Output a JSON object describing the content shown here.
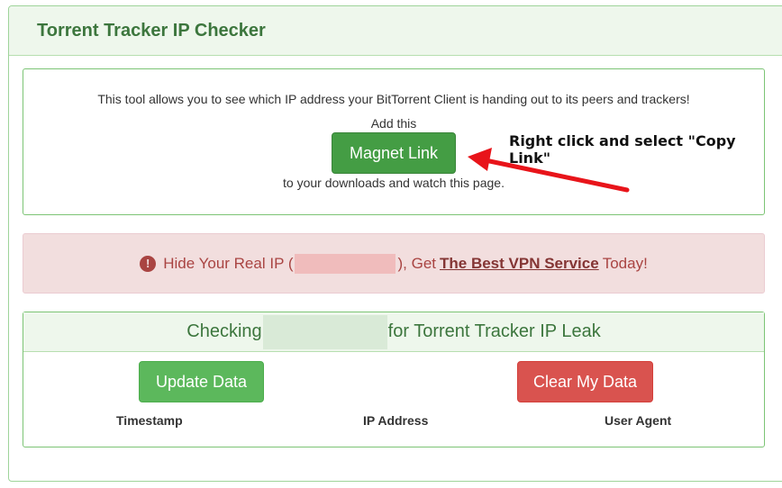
{
  "panel": {
    "title": "Torrent Tracker IP Checker"
  },
  "intro": {
    "description": "This tool allows you to see which IP address your BitTorrent Client is handing out to its peers and trackers!",
    "add_this": "Add this",
    "magnet_button": "Magnet Link",
    "after": "to your downloads and watch this page.",
    "annotation": "Right click and select \"Copy Link\""
  },
  "alert": {
    "prefix": "Hide Your Real IP (",
    "middle": "), Get",
    "link": "The Best VPN Service",
    "suffix": "Today!",
    "icon": "exclamation-circle-icon"
  },
  "checker": {
    "prefix": "Checking",
    "suffix": "for Torrent Tracker IP Leak",
    "update_button": "Update Data",
    "clear_button": "Clear My Data",
    "columns": [
      "Timestamp",
      "IP Address",
      "User Agent"
    ]
  },
  "colors": {
    "success": "#5cb85c",
    "danger": "#d9534f",
    "panel_title": "#3c763d",
    "alert_text": "#a94442",
    "arrow": "#e8141a"
  }
}
